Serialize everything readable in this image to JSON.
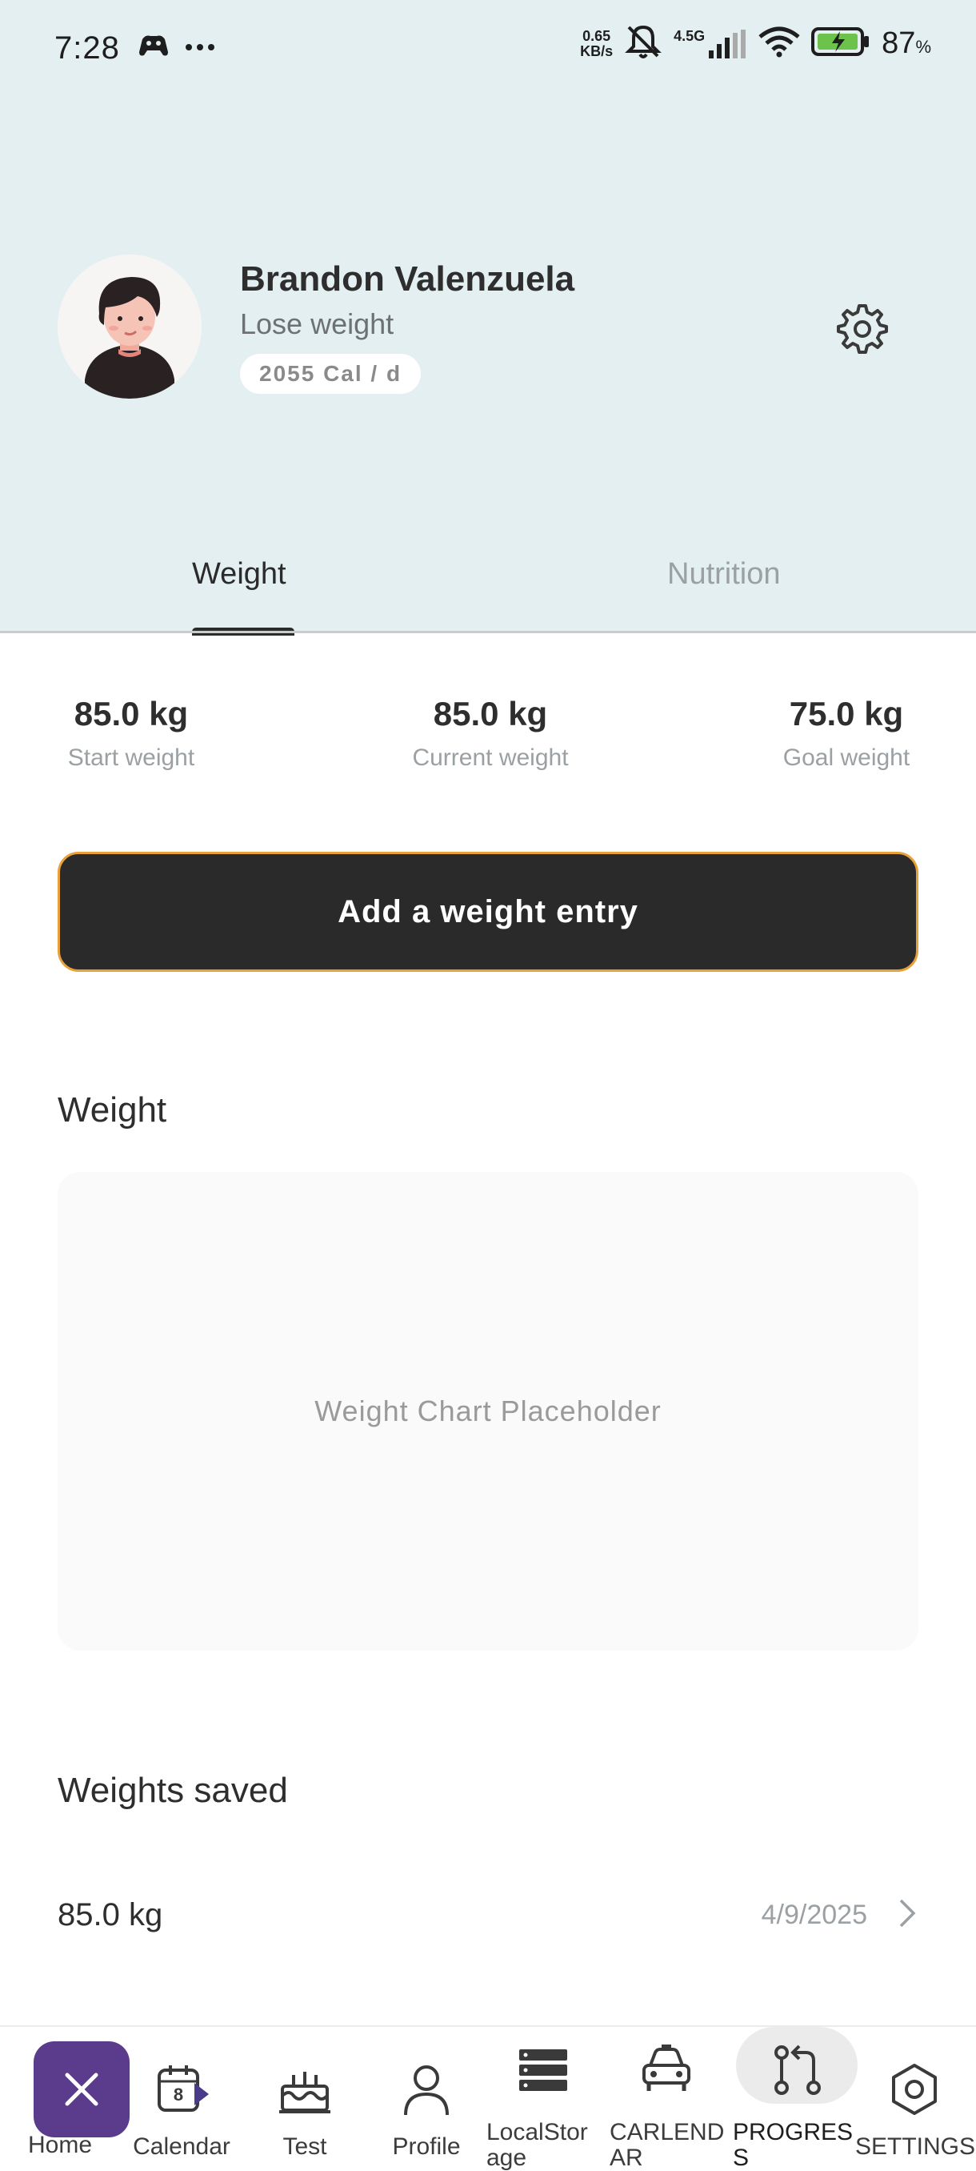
{
  "status_bar": {
    "time": "7:28",
    "net_speed_value": "0.65",
    "net_speed_unit": "KB/s",
    "network_label": "4.5G",
    "battery_percent": "87",
    "battery_unit": "%"
  },
  "profile": {
    "name": "Brandon Valenzuela",
    "goal": "Lose weight",
    "calories": "2055 Cal / d"
  },
  "tabs": [
    {
      "label": "Weight",
      "active": true
    },
    {
      "label": "Nutrition",
      "active": false
    }
  ],
  "stats": {
    "start": {
      "value": "85.0 kg",
      "label": "Start weight"
    },
    "current": {
      "value": "85.0 kg",
      "label": "Current weight"
    },
    "goal": {
      "value": "75.0 kg",
      "label": "Goal weight"
    }
  },
  "add_button_label": "Add a weight entry",
  "weight_section": {
    "title": "Weight",
    "chart_placeholder": "Weight Chart Placeholder"
  },
  "saved_section": {
    "title": "Weights saved",
    "entries": [
      {
        "weight": "85.0 kg",
        "date": "4/9/2025"
      }
    ]
  },
  "bottom_nav": {
    "items": [
      {
        "label": "Home",
        "icon": "home-icon"
      },
      {
        "label": "Calendar",
        "icon": "calendar-icon",
        "badge": "8"
      },
      {
        "label": "Test",
        "icon": "cake-icon"
      },
      {
        "label": "Profile",
        "icon": "person-icon"
      },
      {
        "label": "LocalStor\nage",
        "icon": "database-icon"
      },
      {
        "label": "CARLEND\nAR",
        "icon": "car-icon"
      },
      {
        "label": "PROGRES\nS",
        "icon": "git-compare-icon",
        "active": true
      },
      {
        "label": "SETTINGS",
        "icon": "hexagon-settings-icon"
      }
    ]
  },
  "colors": {
    "header_bg": "#e3eff1",
    "button_bg": "#2a2a2a",
    "button_border": "#e7a13a",
    "fab_bg": "#5a3b8c"
  }
}
